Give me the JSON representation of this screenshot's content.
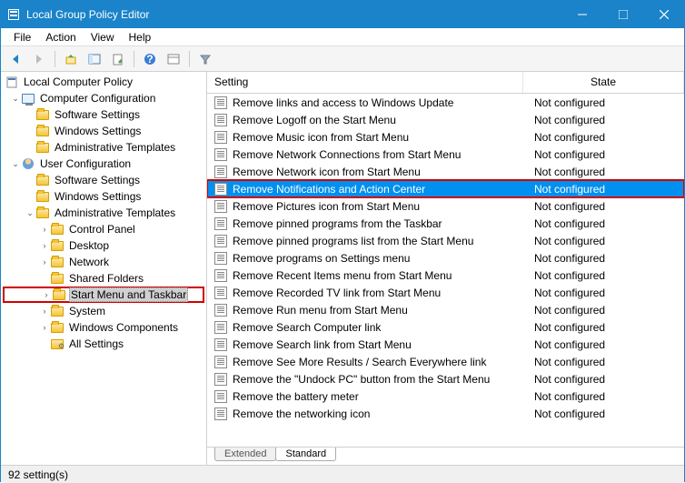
{
  "window": {
    "title": "Local Group Policy Editor"
  },
  "menubar": [
    "File",
    "Action",
    "View",
    "Help"
  ],
  "tree": {
    "root": "Local Computer Policy",
    "comp_cfg": "Computer Configuration",
    "sw": "Software Settings",
    "win": "Windows Settings",
    "adm": "Administrative Templates",
    "user_cfg": "User Configuration",
    "cp": "Control Panel",
    "desktop": "Desktop",
    "network": "Network",
    "shared": "Shared Folders",
    "start": "Start Menu and Taskbar",
    "system": "System",
    "wincomp": "Windows Components",
    "allset": "All Settings"
  },
  "columns": {
    "setting": "Setting",
    "state": "State"
  },
  "rows": [
    {
      "s": "Remove links and access to Windows Update",
      "st": "Not configured"
    },
    {
      "s": "Remove Logoff on the Start Menu",
      "st": "Not configured"
    },
    {
      "s": "Remove Music icon from Start Menu",
      "st": "Not configured"
    },
    {
      "s": "Remove Network Connections from Start Menu",
      "st": "Not configured"
    },
    {
      "s": "Remove Network icon from Start Menu",
      "st": "Not configured"
    },
    {
      "s": "Remove Notifications and Action Center",
      "st": "Not configured",
      "sel": true,
      "hl": true
    },
    {
      "s": "Remove Pictures icon from Start Menu",
      "st": "Not configured"
    },
    {
      "s": "Remove pinned programs from the Taskbar",
      "st": "Not configured"
    },
    {
      "s": "Remove pinned programs list from the Start Menu",
      "st": "Not configured"
    },
    {
      "s": "Remove programs on Settings menu",
      "st": "Not configured"
    },
    {
      "s": "Remove Recent Items menu from Start Menu",
      "st": "Not configured"
    },
    {
      "s": "Remove Recorded TV link from Start Menu",
      "st": "Not configured"
    },
    {
      "s": "Remove Run menu from Start Menu",
      "st": "Not configured"
    },
    {
      "s": "Remove Search Computer link",
      "st": "Not configured"
    },
    {
      "s": "Remove Search link from Start Menu",
      "st": "Not configured"
    },
    {
      "s": "Remove See More Results / Search Everywhere link",
      "st": "Not configured"
    },
    {
      "s": "Remove the \"Undock PC\" button from the Start Menu",
      "st": "Not configured"
    },
    {
      "s": "Remove the battery meter",
      "st": "Not configured"
    },
    {
      "s": "Remove the networking icon",
      "st": "Not configured"
    }
  ],
  "tabs": {
    "extended": "Extended",
    "standard": "Standard"
  },
  "status": "92 setting(s)"
}
